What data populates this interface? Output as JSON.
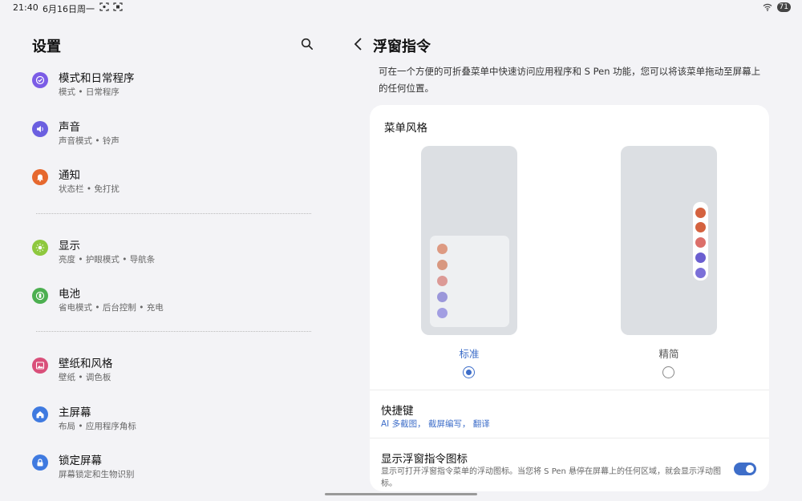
{
  "status_bar": {
    "time": "21:40",
    "date": "6月16日周一",
    "battery": "71"
  },
  "left": {
    "title": "设置",
    "items": [
      {
        "label": "模式和日常程序",
        "sub": "模式 • 日常程序",
        "icon": "check-circle-icon",
        "color": "#7b5ce6"
      },
      {
        "label": "声音",
        "sub": "声音模式 • 铃声",
        "icon": "speaker-icon",
        "color": "#6b5fe0"
      },
      {
        "label": "通知",
        "sub": "状态栏 • 免打扰",
        "icon": "bell-icon",
        "color": "#e6682e"
      },
      {
        "label": "显示",
        "sub": "亮度 • 护眼模式 • 导航条",
        "icon": "sun-icon",
        "color": "#8ec83e"
      },
      {
        "label": "电池",
        "sub": "省电模式 • 后台控制 • 充电",
        "icon": "battery-icon",
        "color": "#4caf50"
      },
      {
        "label": "壁纸和风格",
        "sub": "壁纸 • 调色板",
        "icon": "image-icon",
        "color": "#d94f7a"
      },
      {
        "label": "主屏幕",
        "sub": "布局 • 应用程序角标",
        "icon": "home-icon",
        "color": "#3f7ae0"
      },
      {
        "label": "锁定屏幕",
        "sub": "屏幕锁定和生物识别",
        "icon": "lock-icon",
        "color": "#3f7ae0"
      }
    ]
  },
  "right": {
    "title": "浮窗指令",
    "description": "可在一个方便的可折叠菜单中快速访问应用程序和 S Pen 功能，您可以将该菜单拖动至屏幕上的任何位置。",
    "menu_style": {
      "title": "菜单风格",
      "options": [
        {
          "label": "标准",
          "selected": true
        },
        {
          "label": "精简",
          "selected": false
        }
      ]
    },
    "shortcuts": {
      "title": "快捷键",
      "value": "AI 多截图， 截屏编写， 翻译"
    },
    "show_icon": {
      "title": "显示浮窗指令图标",
      "description": "显示可打开浮窗指令菜单的浮动图标。当您将 S Pen 悬停在屏幕上的任何区域，就会显示浮动图标。",
      "enabled": true
    }
  },
  "colors": {
    "accent": "#3e6ec9",
    "dot_std": [
      "#dd9a82",
      "#d89880",
      "#dc9a96",
      "#9b97da",
      "#a29ee2"
    ],
    "dot_slim": [
      "#d4623f",
      "#d4623f",
      "#dc6f6a",
      "#6b5fd0",
      "#7b70d8"
    ]
  }
}
